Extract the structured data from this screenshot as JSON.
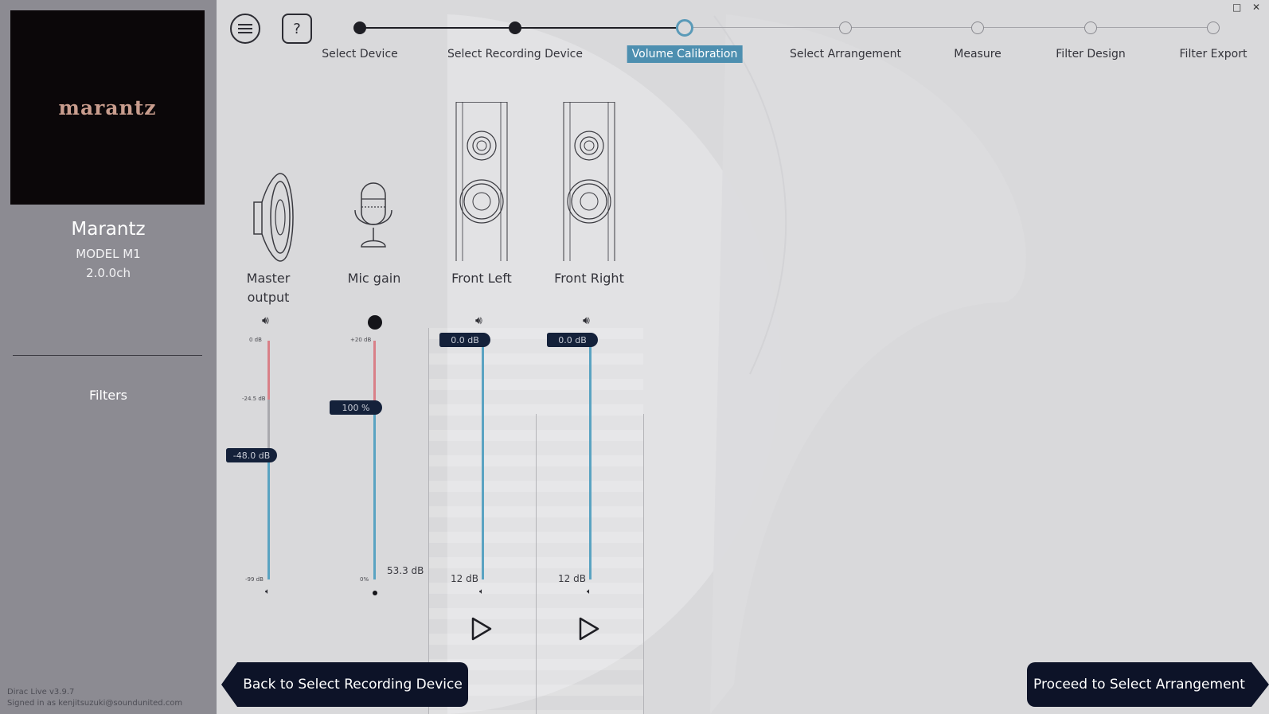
{
  "window": {
    "maximize_icon": "□",
    "close_icon": "✕"
  },
  "sidebar": {
    "logo_text": "marantz",
    "brand_name": "Marantz",
    "model": "MODEL M1",
    "channels": "2.0.0ch",
    "filters_label": "Filters",
    "version": "Dirac Live v3.9.7",
    "signed_in": "Signed in as kenjitsuzuki@soundunited.com"
  },
  "toolbar": {
    "menu_icon": "hamburger-icon",
    "help_label": "?"
  },
  "steps": [
    {
      "label": "Select Device",
      "state": "done"
    },
    {
      "label": "Select Recording Device",
      "state": "done"
    },
    {
      "label": "Volume Calibration",
      "state": "current"
    },
    {
      "label": "Select Arrangement",
      "state": "todo"
    },
    {
      "label": "Measure",
      "state": "todo"
    },
    {
      "label": "Filter Design",
      "state": "todo"
    },
    {
      "label": "Filter Export",
      "state": "todo"
    }
  ],
  "colors": {
    "accent": "#4d8fb0",
    "dark_navy": "#0d1328",
    "level_red": "#d98088",
    "track_blue": "#5aa3c2"
  },
  "channels": {
    "master": {
      "label_line1": "Master",
      "label_line2": "output",
      "top_tick": "0 dB",
      "mid_tick": "-24.5 dB",
      "bottom_tick": "-99 dB",
      "value": "-48.0 dB",
      "icon": "speaker-icon"
    },
    "mic": {
      "label": "Mic gain",
      "top_tick": "+20 dB",
      "bottom_tick": "0%",
      "value": "100 %",
      "level": "53.3 dB",
      "icon": "microphone-icon"
    },
    "front_left": {
      "label": "Front Left",
      "value": "0.0 dB",
      "bottom_value": "12 dB",
      "icon": "tower-speaker-icon"
    },
    "front_right": {
      "label": "Front Right",
      "value": "0.0 dB",
      "bottom_value": "12 dB",
      "icon": "tower-speaker-icon"
    }
  },
  "nav": {
    "back_label": "Back to Select Recording Device",
    "next_label": "Proceed to Select Arrangement"
  }
}
